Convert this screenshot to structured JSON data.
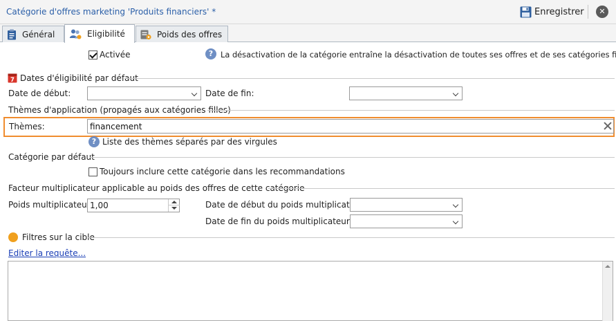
{
  "window": {
    "title": "Catégorie d'offres marketing 'Produits financiers' *",
    "save_label": "Enregistrer",
    "close_label": "✕"
  },
  "tabs": [
    {
      "label": "Général",
      "icon": "clipboard-icon"
    },
    {
      "label": "Eligibilité",
      "icon": "users-icon",
      "active": true
    },
    {
      "label": "Poids des offres",
      "icon": "weights-icon"
    }
  ],
  "general": {
    "active_label": "Activée",
    "active_checked": true,
    "active_help": "La désactivation de la catégorie entraîne la désactivation de toutes ses offres et de ses catégories filles."
  },
  "dates": {
    "section_title": "Dates d'éligibilité par défaut",
    "calendar_icon_text": "7",
    "start_label": "Date de début:",
    "start_value": "",
    "end_label": "Date de fin:",
    "end_value": ""
  },
  "themes": {
    "section_title": "Thèmes d'application (propagés aux catégories filles)",
    "label": "Thèmes:",
    "value": "financement",
    "help": "Liste des thèmes séparés par des virgules"
  },
  "default_category": {
    "section_title": "Catégorie par défaut",
    "always_include_label": "Toujours inclure cette catégorie dans les recommandations",
    "always_include_checked": false
  },
  "weight_factor": {
    "section_title": "Facteur multiplicateur applicable au poids des offres de cette catégorie",
    "weight_label": "Poids multiplicateur:",
    "weight_value": "1,00",
    "start_label": "Date de début du poids multiplicateur:",
    "start_value": "",
    "end_label": "Date de fin du poids multiplicateur:",
    "end_value": ""
  },
  "filters": {
    "section_title": "Filtres sur la cible",
    "edit_link": "Editer la requête...",
    "query_text": ""
  },
  "colors": {
    "title_blue": "#2b5fa8",
    "highlight_orange": "#f08c2e",
    "link_blue": "#1b3fb6"
  }
}
